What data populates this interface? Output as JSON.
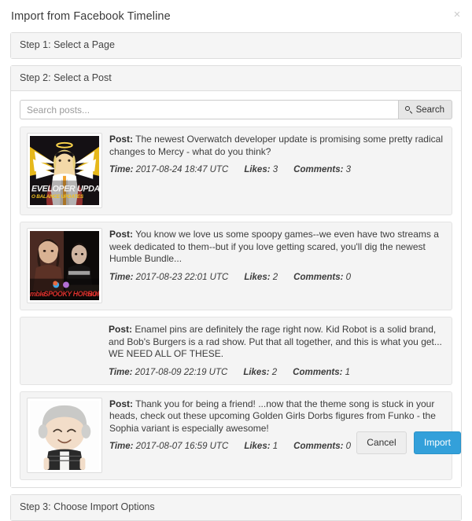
{
  "modal": {
    "title": "Import from Facebook Timeline",
    "close_label": "×",
    "close_icon": "close-icon"
  },
  "steps": [
    {
      "id": "step-1",
      "title": "Step 1: Select a Page",
      "open": false
    },
    {
      "id": "step-2",
      "title": "Step 2: Select a Post",
      "open": true
    },
    {
      "id": "step-3",
      "title": "Step 3: Choose Import Options",
      "open": false
    }
  ],
  "search": {
    "placeholder": "Search posts...",
    "value": "",
    "button_label": "Search",
    "button_icon": "search-icon"
  },
  "labels": {
    "post": "Post:",
    "time": "Time:",
    "likes": "Likes:",
    "comments": "Comments:"
  },
  "posts": [
    {
      "text": "The newest Overwatch developer update is promising some pretty radical changes to Mercy - what do you think?",
      "time": "2017-08-24 18:47 UTC",
      "likes": "3",
      "comments": "3",
      "thumbnail": "overwatch-mercy-developer-update",
      "has_thumbnail": true,
      "thumb_caption_line1": "EVELOPER UPDATE",
      "thumb_caption_line2": "O BALANCE UPDATES"
    },
    {
      "text": "You know we love us some spoopy games--we even have two streams a week dedicated to them--but if you love getting scared, you'll dig the newest Humble Bundle...",
      "time": "2017-08-23 22:01 UTC",
      "likes": "2",
      "comments": "0",
      "thumbnail": "humble-spooky-horror-bundle",
      "has_thumbnail": true,
      "thumb_caption_line1": "mble SPOOKY HORROR Bu",
      "thumb_caption_line2": ""
    },
    {
      "text": "Enamel pins are definitely the rage right now. Kid Robot is a solid brand, and Bob's Burgers is a rad show. Put that all together, and this is what you get... WE NEED ALL OF THESE.",
      "time": "2017-08-09 22:19 UTC",
      "likes": "2",
      "comments": "1",
      "thumbnail": "",
      "has_thumbnail": false,
      "thumb_caption_line1": "",
      "thumb_caption_line2": ""
    },
    {
      "text": "Thank you for being a friend! ...now that the theme song is stuck in your heads, check out these upcoming Golden Girls Dorbs figures from Funko - the Sophia variant is especially awesome!",
      "time": "2017-08-07 16:59 UTC",
      "likes": "1",
      "comments": "0",
      "thumbnail": "golden-girls-sophia-dorbs-figure",
      "has_thumbnail": true,
      "thumb_caption_line1": "",
      "thumb_caption_line2": ""
    }
  ],
  "footer": {
    "cancel_label": "Cancel",
    "import_label": "Import"
  },
  "colors": {
    "primary": "#33a0da",
    "panel_header_bg": "#f5f5f5",
    "post_bg": "#f4f4f4",
    "border": "#dddddd"
  }
}
